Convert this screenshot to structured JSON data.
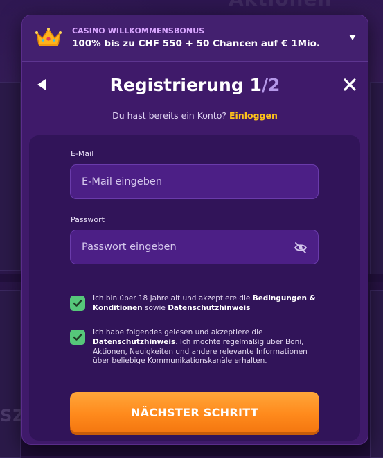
{
  "background": {
    "heading": "Aktionen",
    "side_text": "SZA"
  },
  "banner": {
    "label": "CASINO WILLKOMMENSBONUS",
    "title": "100% bis zu CHF 550 + 50 Chancen auf € 1Mio.",
    "icon": "crown-icon",
    "toggle_icon": "chevron-down-icon"
  },
  "header": {
    "title": "Registrierung",
    "step_current": "1",
    "step_total": "/2",
    "back_icon": "back-arrow-icon",
    "close_icon": "close-icon"
  },
  "login": {
    "prompt": "Du hast bereits ein Konto?",
    "link": "Einloggen"
  },
  "form": {
    "email_label": "E-Mail",
    "email_placeholder": "E-Mail eingeben",
    "password_label": "Passwort",
    "password_placeholder": "Passwort eingeben",
    "password_toggle_icon": "eye-off-icon"
  },
  "consents": [
    {
      "checked": true,
      "text_1": "Ich bin über 18 Jahre alt und akzeptiere die",
      "terms_link": "Bedingungen & Konditionen",
      "text_2": "sowie",
      "privacy_link": "Datenschutzhinweis"
    },
    {
      "checked": true,
      "text_1": "Ich habe folgendes gelesen und akzeptiere die",
      "privacy_link": "Datenschutzhinweis",
      "text_2": ". Ich möchte regelmäßig über Boni, Aktionen, Neuigkeiten und andere relevante Informationen über beliebige Kommunikationskanäle erhalten."
    }
  ],
  "next_button": "NÄCHSTER SCHRITT",
  "colors": {
    "modal_bg": "#3f1a6a",
    "card_bg": "#311459",
    "input_bg": "#4c1f86",
    "accent_link": "#ffc21a",
    "check_green": "#56c77a",
    "button_orange": "#ff8a1c",
    "label_purple": "#d9a6ff"
  }
}
